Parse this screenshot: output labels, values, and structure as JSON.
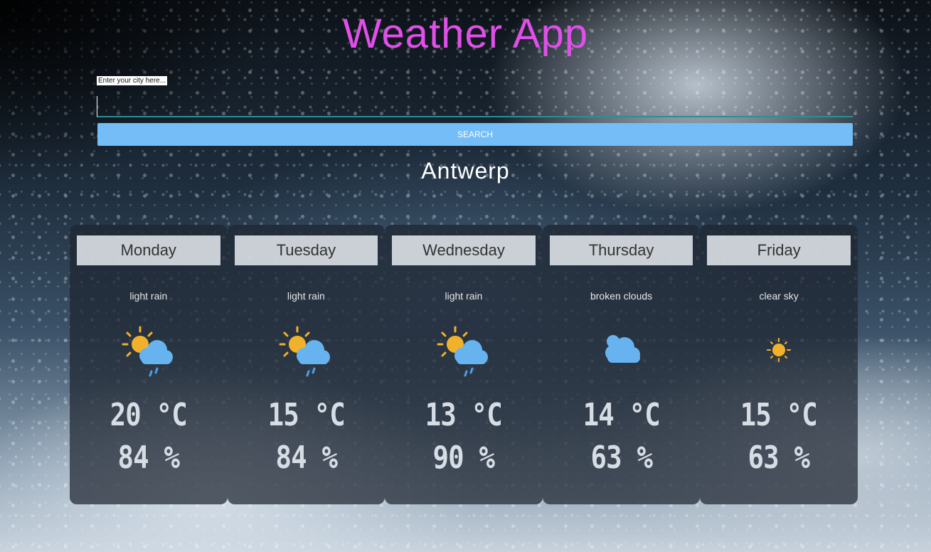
{
  "app": {
    "title": "Weather App"
  },
  "search": {
    "label": "Enter your city here...",
    "value": "",
    "button_label": "SEARCH"
  },
  "city": "Antwerp",
  "forecast": [
    {
      "day": "Monday",
      "description": "light rain",
      "icon": "sun-cloud-rain-icon",
      "temp": "20 °C",
      "humidity": "84 %"
    },
    {
      "day": "Tuesday",
      "description": "light rain",
      "icon": "sun-cloud-rain-icon",
      "temp": "15 °C",
      "humidity": "84 %"
    },
    {
      "day": "Wednesday",
      "description": "light rain",
      "icon": "sun-cloud-rain-icon",
      "temp": "13 °C",
      "humidity": "90 %"
    },
    {
      "day": "Thursday",
      "description": "broken clouds",
      "icon": "cloud-icon",
      "temp": "14 °C",
      "humidity": "63 %"
    },
    {
      "day": "Friday",
      "description": "clear sky",
      "icon": "sun-icon",
      "temp": "15 °C",
      "humidity": "63 %"
    }
  ],
  "colors": {
    "title": "#e04fe8",
    "button": "#74bdf6",
    "sun": "#f2b12a",
    "cloud": "#66b3f0",
    "rain": "#4f9fe4"
  }
}
